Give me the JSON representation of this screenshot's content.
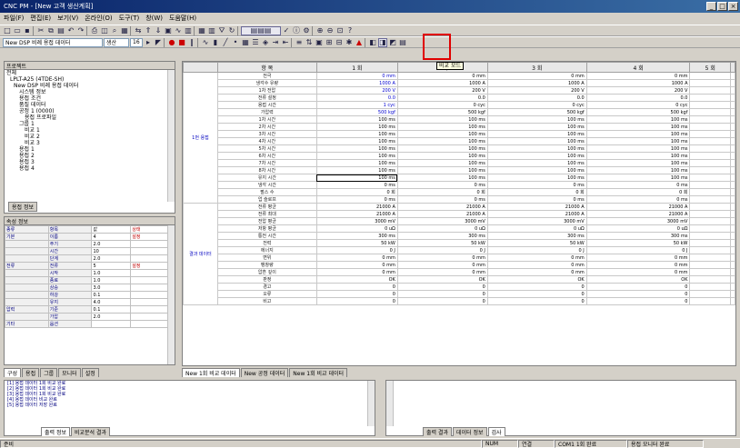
{
  "window": {
    "title": "CNC PM - [New 고객 생산계획]"
  },
  "menu": [
    "파일(F)",
    "편집(E)",
    "보기(V)",
    "온라인(O)",
    "도구(T)",
    "창(W)",
    "도움말(H)"
  ],
  "toolbar": {
    "combo1": "New DSP 비례 용접 데이터",
    "combo2": "생산",
    "combo3": "16"
  },
  "tooltip": "비교 모드",
  "tree": {
    "title": "프로젝트",
    "nodes": [
      "전체",
      "LPLT-A25 (4TDE-SH)",
      "New DSP 비례 용접 데이터",
      "시스템 정보",
      "용접 조건",
      "품질 데이터",
      "공정 1 (0000)",
      "용접 프로파일",
      "그룹 1",
      "비교 1",
      "비교 2",
      "비교 3",
      "용접 1",
      "용접 2",
      "용접 3",
      "용접 4"
    ],
    "tab": "용접 정보"
  },
  "props": {
    "title": "속성 정보",
    "rows": [
      [
        "종류",
        "항목",
        "값",
        "상태"
      ],
      [
        "기본",
        "이름",
        "4",
        "설정"
      ],
      [
        "",
        "주기",
        "2.0",
        ""
      ],
      [
        "",
        "시간",
        "10",
        ""
      ],
      [
        "",
        "단계",
        "2.0",
        ""
      ],
      [
        "전류",
        "전류",
        "5",
        "설정"
      ],
      [
        "",
        "시작",
        "1.0",
        ""
      ],
      [
        "",
        "종료",
        "1.0",
        ""
      ],
      [
        "",
        "상승",
        "3.0",
        ""
      ],
      [
        "",
        "하강",
        "0.1",
        ""
      ],
      [
        "",
        "유지",
        "4.0",
        ""
      ],
      [
        "압력",
        "기준",
        "0.1",
        ""
      ],
      [
        "",
        "가압",
        "2.0",
        ""
      ],
      [
        "기타",
        "옵션",
        "",
        ""
      ]
    ]
  },
  "grid": {
    "headers": [
      "항 목",
      "1 회",
      "2 회",
      "3 회",
      "4 회",
      "5 회"
    ],
    "group1": "1번 용접",
    "group2": "결과 데이터",
    "rows1": [
      [
        "전극",
        "0 mm",
        "0 mm",
        "0 mm",
        "0 mm"
      ],
      [
        "냉각수 유량",
        "1000 A",
        "1000 A",
        "1000 A",
        "1000 A"
      ],
      [
        "1차 전압",
        "200 V",
        "200 V",
        "200 V",
        "200 V"
      ],
      [
        "전류 설정",
        "0.0",
        "0.0",
        "0.0",
        "0.0"
      ],
      [
        "용접 시간",
        "1 cyc",
        "0 cyc",
        "0 cyc",
        "0 cyc"
      ],
      [
        "가압력",
        "500 kgf",
        "500 kgf",
        "500 kgf",
        "500 kgf"
      ],
      [
        "1차 시간",
        "100 ms",
        "100 ms",
        "100 ms",
        "100 ms"
      ],
      [
        "2차 시간",
        "100 ms",
        "100 ms",
        "100 ms",
        "100 ms"
      ],
      [
        "3차 시간",
        "100 ms",
        "100 ms",
        "100 ms",
        "100 ms"
      ],
      [
        "4차 시간",
        "100 ms",
        "100 ms",
        "100 ms",
        "100 ms"
      ],
      [
        "5차 시간",
        "100 ms",
        "100 ms",
        "100 ms",
        "100 ms"
      ],
      [
        "6차 시간",
        "100 ms",
        "100 ms",
        "100 ms",
        "100 ms"
      ],
      [
        "7차 시간",
        "100 ms",
        "100 ms",
        "100 ms",
        "100 ms"
      ],
      [
        "8차 시간",
        "100 ms",
        "100 ms",
        "100 ms",
        "100 ms"
      ],
      [
        "유지 시간",
        "100 ms",
        "100 ms",
        "100 ms",
        "100 ms"
      ],
      [
        "냉각 시간",
        "0 ms",
        "0 ms",
        "0 ms",
        "0 ms"
      ],
      [
        "펄스 수",
        "0 회",
        "0 회",
        "0 회",
        "0 회"
      ],
      [
        "업 슬로프",
        "0 ms",
        "0 ms",
        "0 ms",
        "0 ms"
      ]
    ],
    "rows2": [
      [
        "전류 평균",
        "21000 A",
        "21000 A",
        "21000 A",
        "21000 A"
      ],
      [
        "전류 최대",
        "21000 A",
        "21000 A",
        "21000 A",
        "21000 A"
      ],
      [
        "전압 평균",
        "3000 mV",
        "3000 mV",
        "3000 mV",
        "3000 mV"
      ],
      [
        "저항 평균",
        "0 uΩ",
        "0 uΩ",
        "0 uΩ",
        "0 uΩ"
      ],
      [
        "통전 시간",
        "300 ms",
        "300 ms",
        "300 ms",
        "300 ms"
      ],
      [
        "전력",
        "50 kW",
        "50 kW",
        "50 kW",
        "50 kW"
      ],
      [
        "에너지",
        "0 J",
        "0 J",
        "0 J",
        "0 J"
      ],
      [
        "변위",
        "0 mm",
        "0 mm",
        "0 mm",
        "0 mm"
      ],
      [
        "팽창량",
        "0 mm",
        "0 mm",
        "0 mm",
        "0 mm"
      ],
      [
        "압흔 깊이",
        "0 mm",
        "0 mm",
        "0 mm",
        "0 mm"
      ],
      [
        "판정",
        "OK",
        "OK",
        "OK",
        "OK"
      ],
      [
        "경고",
        "0",
        "0",
        "0",
        "0"
      ],
      [
        "오류",
        "0",
        "0",
        "0",
        "0"
      ],
      [
        "비고",
        "0",
        "0",
        "0",
        "0"
      ]
    ]
  },
  "docTabs": [
    "New 1회 비교 데이터",
    "New 공정 데이터",
    "New 1회 비교 데이터"
  ],
  "leftTabs": [
    "구성",
    "용접",
    "그룹",
    "모니터",
    "설정"
  ],
  "log": {
    "lines": [
      "[1] 용접 데이터 1회 비교 완료",
      "[2] 용접 데이터 1회 비교 완료",
      "[3] 용접 데이터 1회 비교 완료",
      "[4] 용접 데이터 비교 완료",
      "[5] 용접 데이터 저장 완료"
    ],
    "tabs": [
      "출력 정보",
      "비교분석 결과"
    ],
    "tabs2": [
      "출력 결과",
      "데이터 정보",
      "검사"
    ]
  },
  "status": [
    "준비",
    "NUM",
    "연결",
    "COM1 1회 완료",
    "용접 모니터 완료"
  ]
}
